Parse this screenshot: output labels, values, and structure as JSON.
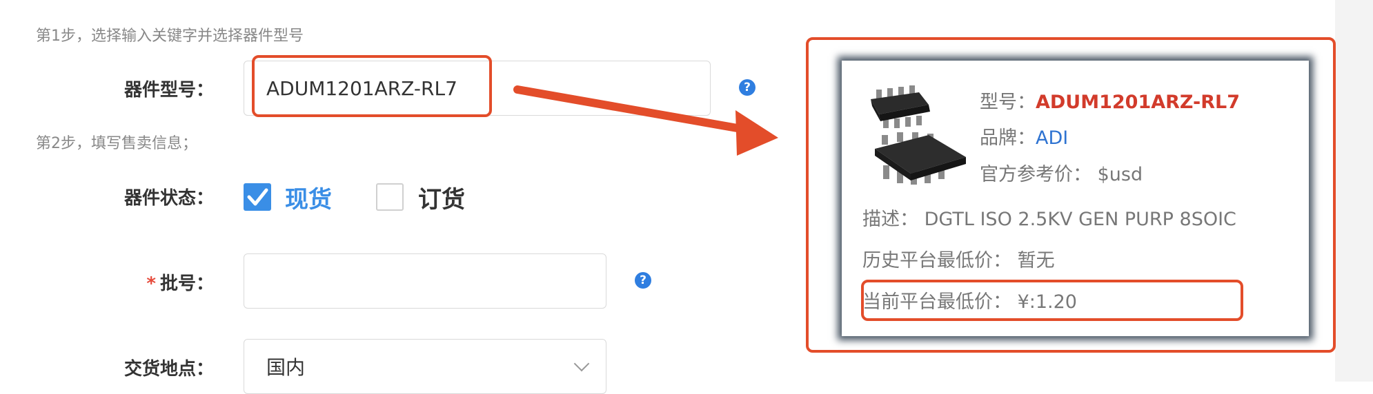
{
  "form": {
    "step1": "第1步，选择输入关键字并选择器件型号",
    "model_label": "器件型号：",
    "model_value": "ADUM1201ARZ-RL7",
    "step2": "第2步，填写售卖信息；",
    "status_label": "器件状态：",
    "status_options": [
      {
        "label": "现货",
        "checked": true
      },
      {
        "label": "订货",
        "checked": false
      }
    ],
    "batch_star": "*",
    "batch_label": "批号：",
    "batch_value": "",
    "location_label": "交货地点：",
    "location_value": "国内",
    "help_glyph": "?"
  },
  "card": {
    "model_label": "型号：",
    "model_value": "ADUM1201ARZ-RL7",
    "brand_label": "品牌：",
    "brand_value": "ADI",
    "ref_price_label": "官方参考价：",
    "ref_price_value": "$usd",
    "desc_label": "描述：",
    "desc_value": "DGTL ISO 2.5KV GEN PURP 8SOIC",
    "hist_low_label": "历史平台最低价：",
    "hist_low_value": "暂无",
    "cur_low_label": "当前平台最低价：",
    "cur_low_value": "¥:1.20"
  },
  "colors": {
    "annotation_red": "#e34d2a",
    "accent_blue": "#3a8ee6",
    "model_red": "#d23b2b",
    "brand_blue": "#2e73d1"
  }
}
